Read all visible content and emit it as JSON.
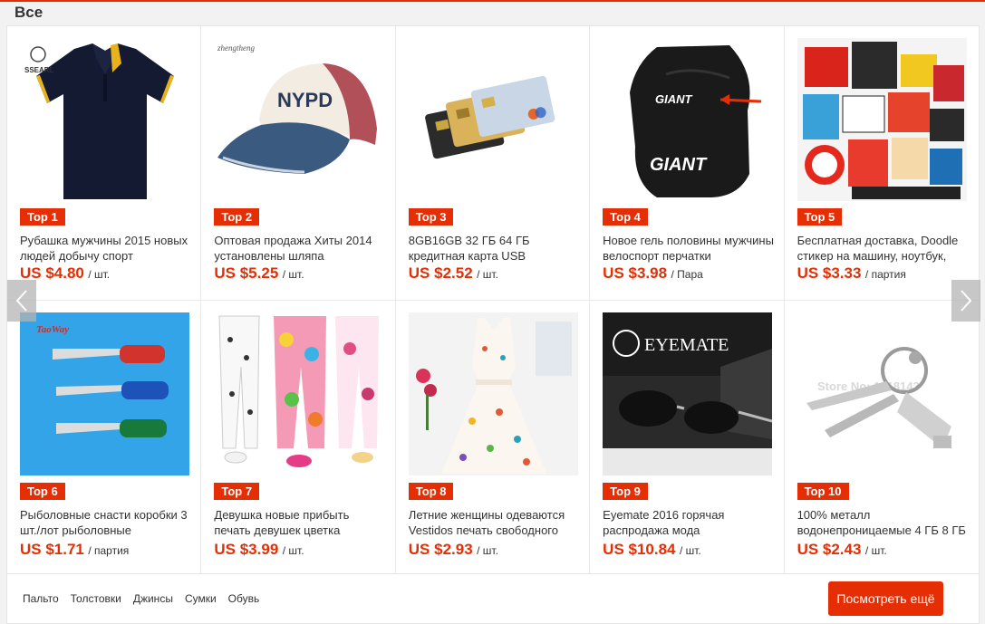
{
  "section": {
    "title": "Все"
  },
  "products": [
    {
      "rank": "Top 1",
      "title": "Рубашка мужчины 2015 новых людей добычу спорт",
      "price": "US $4.80",
      "unit": "/ шт."
    },
    {
      "rank": "Top 2",
      "title": "Оптовая продажа Хиты 2014 установлены шляпа",
      "price": "US $5.25",
      "unit": "/ шт."
    },
    {
      "rank": "Top 3",
      "title": "8GB16GB 32 ГБ 64 ГБ кредитная карта USB",
      "price": "US $2.52",
      "unit": "/ шт."
    },
    {
      "rank": "Top 4",
      "title": "Новое гель половины мужчины велоспорт перчатки",
      "price": "US $3.98",
      "unit": "/ Пара"
    },
    {
      "rank": "Top 5",
      "title": "Бесплатная доставка, Doodle стикер на машину, ноутбук,",
      "price": "US $3.33",
      "unit": "/ партия"
    },
    {
      "rank": "Top 6",
      "title": "Рыболовные снасти коробки 3 шт./лот рыболовные",
      "price": "US $1.71",
      "unit": "/ партия"
    },
    {
      "rank": "Top 7",
      "title": "Девушка новые прибыть печать девушек цветка",
      "price": "US $3.99",
      "unit": "/ шт."
    },
    {
      "rank": "Top 8",
      "title": "Летние женщины одеваются Vestidos печать свободного",
      "price": "US $2.93",
      "unit": "/ шт."
    },
    {
      "rank": "Top 9",
      "title": "Eyemate 2016 горячая распродажа мода",
      "price": "US $10.84",
      "unit": "/ шт."
    },
    {
      "rank": "Top 10",
      "title": "100% металл водонепроницаемые 4 ГБ 8 ГБ",
      "price": "US $2.43",
      "unit": "/ шт."
    }
  ],
  "image_text": {
    "p1_brand": "SSEARL",
    "p2_brand": "zhengtheng",
    "p2_cap": "NYPD",
    "p4_brand": "GIANT",
    "p6_brand": "TaoWay",
    "p9_brand": "EYEMATE",
    "p10_watermark": "Store No: 1018143"
  },
  "categories": [
    "Пальто",
    "Толстовки",
    "Джинсы",
    "Сумки",
    "Обувь"
  ],
  "more_button": "Посмотреть ещё",
  "colors": {
    "accent": "#e62e04",
    "text": "#333333",
    "border": "#e8e8e8"
  }
}
